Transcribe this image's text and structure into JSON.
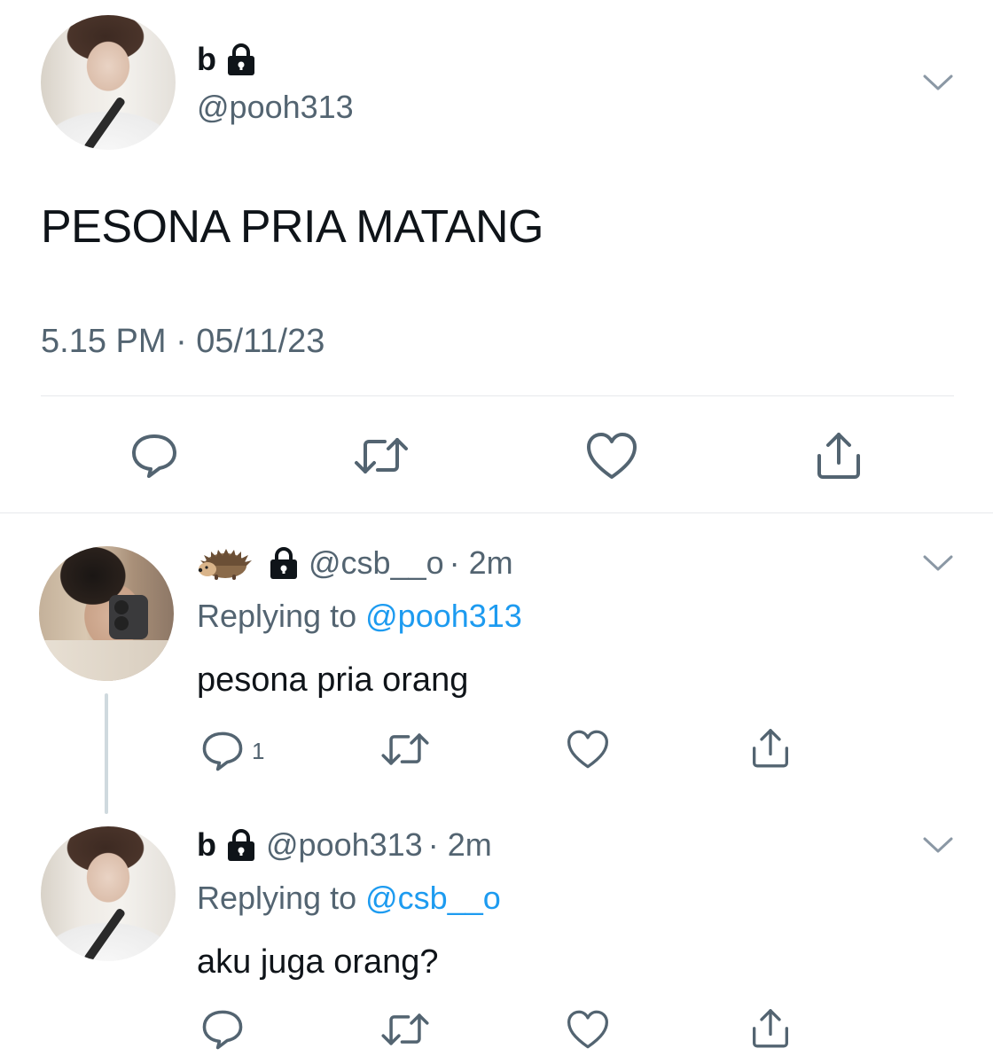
{
  "main_tweet": {
    "display_name": "b",
    "handle": "@pooh313",
    "text": "PESONA PRIA MATANG",
    "timestamp": "5.15 PM · 05/11/23"
  },
  "replies": [
    {
      "display_name": "🦔",
      "handle": "@csb__o",
      "time": "· 2m",
      "replying_label": "Replying to",
      "replying_to": "@pooh313",
      "text": "pesona pria orang",
      "reply_count": "1"
    },
    {
      "display_name": "b",
      "handle": "@pooh313",
      "time": "· 2m",
      "replying_label": "Replying to",
      "replying_to": "@csb__o",
      "text": "aku juga orang?",
      "reply_count": ""
    }
  ],
  "icons": {
    "reply": "speech-bubble-icon",
    "retweet": "retweet-icon",
    "like": "heart-icon",
    "share": "share-icon",
    "more": "chevron-down-icon",
    "protected": "lock-icon"
  },
  "colors": {
    "text": "#0f1419",
    "secondary": "#536471",
    "link": "#1d9bf0",
    "divider": "#e6e9eb"
  }
}
